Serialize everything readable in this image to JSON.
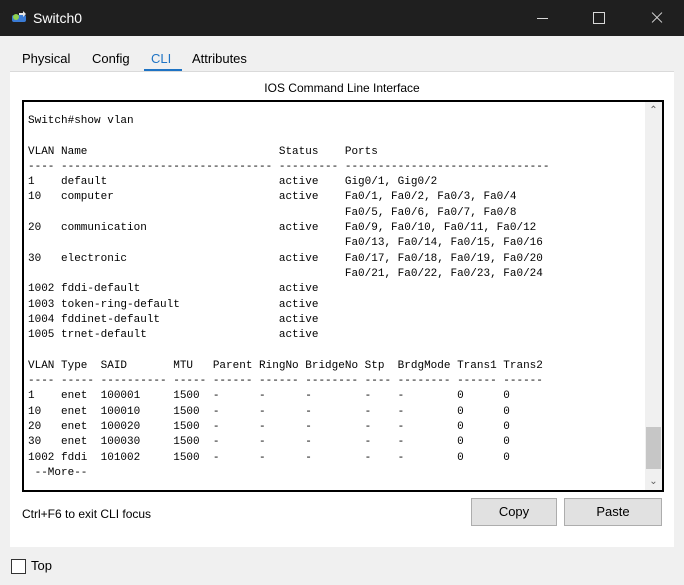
{
  "window": {
    "title": "Switch0",
    "icon": "switch-icon",
    "controls": [
      "minimize-icon",
      "maximize-icon",
      "close-icon"
    ]
  },
  "tabs": [
    {
      "label": "Physical",
      "active": false
    },
    {
      "label": "Config",
      "active": false
    },
    {
      "label": "CLI",
      "active": true
    },
    {
      "label": "Attributes",
      "active": false
    }
  ],
  "panel": {
    "title": "IOS Command Line Interface"
  },
  "cli": {
    "output": "Switch#show vlan\n\nVLAN Name                             Status    Ports\n---- -------------------------------- --------- -------------------------------\n1    default                          active    Gig0/1, Gig0/2\n10   computer                         active    Fa0/1, Fa0/2, Fa0/3, Fa0/4\n                                                Fa0/5, Fa0/6, Fa0/7, Fa0/8\n20   communication                    active    Fa0/9, Fa0/10, Fa0/11, Fa0/12\n                                                Fa0/13, Fa0/14, Fa0/15, Fa0/16\n30   electronic                       active    Fa0/17, Fa0/18, Fa0/19, Fa0/20\n                                                Fa0/21, Fa0/22, Fa0/23, Fa0/24\n1002 fddi-default                     active\n1003 token-ring-default               active\n1004 fddinet-default                  active\n1005 trnet-default                    active\n\nVLAN Type  SAID       MTU   Parent RingNo BridgeNo Stp  BrdgMode Trans1 Trans2\n---- ----- ---------- ----- ------ ------ -------- ---- -------- ------ ------\n1    enet  100001     1500  -      -      -        -    -        0      0\n10   enet  100010     1500  -      -      -        -    -        0      0\n20   enet  100020     1500  -      -      -        -    -        0      0\n30   enet  100030     1500  -      -      -        -    -        0      0\n1002 fddi  101002     1500  -      -      -        -    -        0      0\n --More--"
  },
  "footer": {
    "hint": "Ctrl+F6 to exit CLI focus",
    "copy_label": "Copy",
    "paste_label": "Paste"
  },
  "top_checkbox": {
    "label": "Top",
    "checked": false
  },
  "colors": {
    "titlebar": "#1f1f1f",
    "accent": "#1e73c4",
    "window_bg": "#f0f0f0",
    "panel_bg": "#ffffff"
  }
}
